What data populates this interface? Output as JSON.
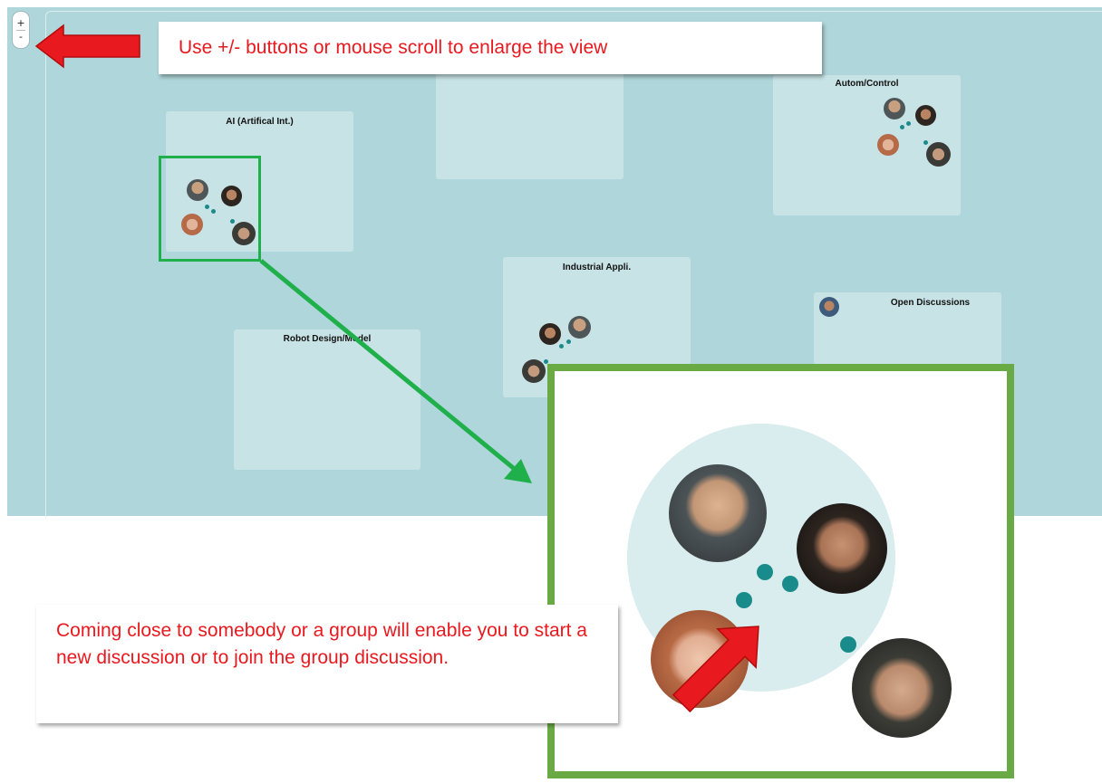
{
  "zoom_controls": {
    "plus": "+",
    "minus": "-"
  },
  "hint_top": "Use +/- buttons or mouse scroll to enlarge the view",
  "hint_bottom": "Coming close to somebody or a group will enable you to start a new discussion or to join the group discussion.",
  "rooms": [
    {
      "title": "AI (Artifical Int.)"
    },
    {
      "title": ""
    },
    {
      "title": "Autom/Control"
    },
    {
      "title": "Industrial Appli."
    },
    {
      "title": "Open Discussions"
    },
    {
      "title": "Robot Design/Model"
    }
  ],
  "icons": [
    "avatar-icon",
    "arrow-left-icon",
    "arrow-diagonal-icon"
  ],
  "colors": {
    "canvas": "#afd6da",
    "room": "#c8e3e6",
    "dot": "#1a8b8b",
    "callout_text": "#e8191f",
    "highlight_green": "#20b04b",
    "zoom_border": "#6aaa45",
    "arrow_red": "#e8191f"
  }
}
